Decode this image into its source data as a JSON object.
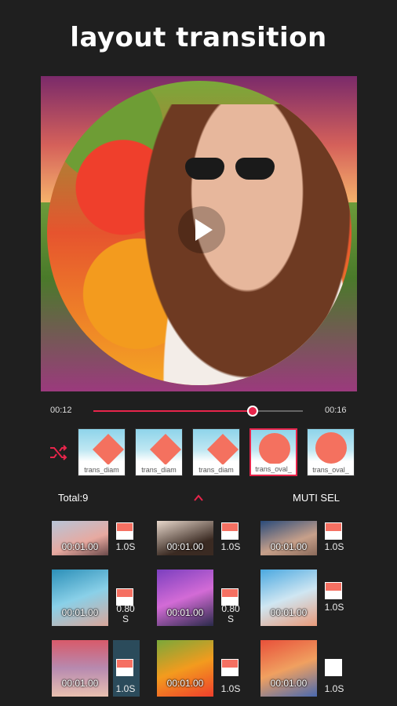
{
  "header": {
    "title": "layout transition"
  },
  "player": {
    "current_time": "00:12",
    "total_time": "00:16",
    "progress": 0.76
  },
  "transitions": [
    {
      "label": "trans_diam",
      "shape": "diamond",
      "selected": false
    },
    {
      "label": "trans_diam",
      "shape": "diamond",
      "selected": false
    },
    {
      "label": "trans_diam",
      "shape": "diamond",
      "selected": false
    },
    {
      "label": "trans_oval_",
      "shape": "oval",
      "selected": true
    },
    {
      "label": "trans_oval_",
      "shape": "oval",
      "selected": false
    }
  ],
  "clips_bar": {
    "total_label": "Total:9",
    "multi_select_label": "MUTI SEL"
  },
  "clips": [
    {
      "time": "00:01.00",
      "duration": "1.0S"
    },
    {
      "time": "00:01.00",
      "duration": "1.0S"
    },
    {
      "time": "00:01.00",
      "duration": "1.0S"
    },
    {
      "time": "00:01.00",
      "duration": "0.80 S"
    },
    {
      "time": "00:01.00",
      "duration": "0.80 S"
    },
    {
      "time": "00:01.00",
      "duration": "1.0S"
    },
    {
      "time": "00:01.00",
      "duration": "1.0S"
    },
    {
      "time": "00:01.00",
      "duration": "1.0S"
    },
    {
      "time": "00:01.00",
      "duration": "1.0S"
    }
  ],
  "colors": {
    "accent": "#e8254b",
    "background": "#1f1f1f",
    "transition_shape": "#f4715f"
  },
  "icons": {
    "play": "play-icon",
    "shuffle": "shuffle-icon",
    "collapse": "chevron-up-icon"
  }
}
